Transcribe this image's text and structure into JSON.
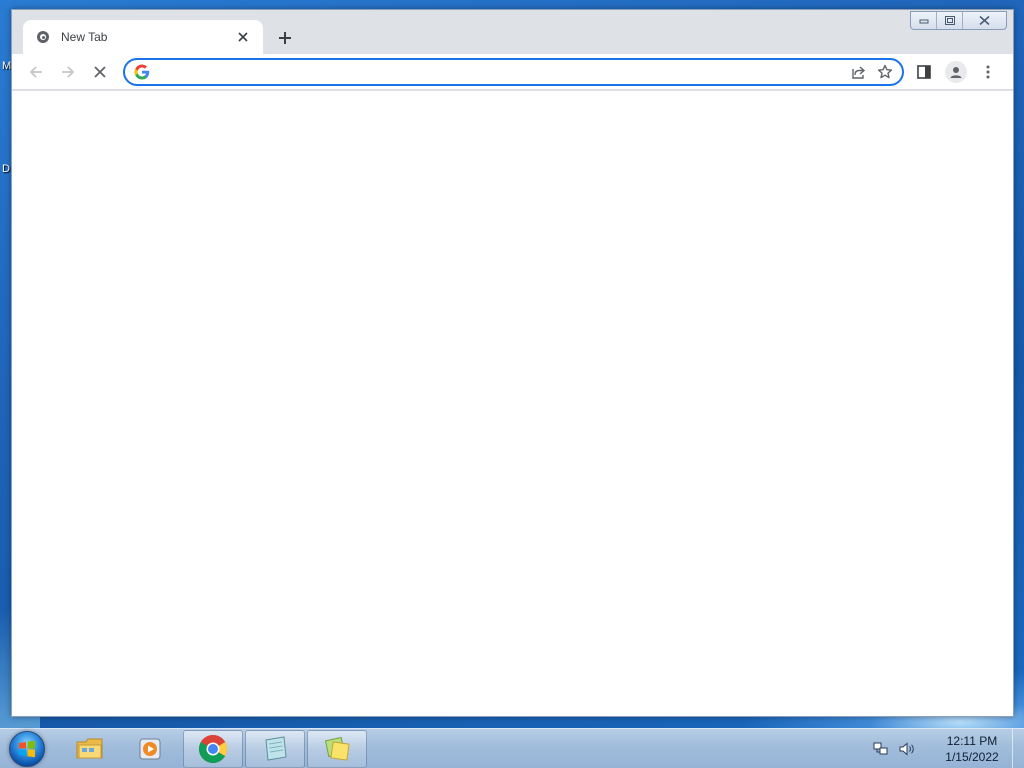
{
  "desktop": {
    "edge_labels": [
      "M",
      "D"
    ]
  },
  "browser": {
    "tab": {
      "title": "New Tab"
    },
    "omnibox": {
      "value": "",
      "placeholder": ""
    }
  },
  "icons": {
    "tab_favicon": "chrome-favicon-icon",
    "tab_close": "close-icon",
    "new_tab": "plus-icon",
    "back": "arrow-left-icon",
    "forward": "arrow-right-icon",
    "stop": "stop-icon",
    "google": "google-g-icon",
    "share": "share-icon",
    "bookmark": "star-icon",
    "side_panel": "side-panel-icon",
    "profile": "profile-icon",
    "menu": "kebab-menu-icon"
  },
  "taskbar": {
    "items": [
      {
        "name": "windows-explorer",
        "icon": "folder-icon",
        "open": false
      },
      {
        "name": "media-player",
        "icon": "media-player-icon",
        "open": false
      },
      {
        "name": "chrome",
        "icon": "chrome-icon",
        "open": true
      },
      {
        "name": "notepad",
        "icon": "notepad-icon",
        "open": true
      },
      {
        "name": "sticky-notes",
        "icon": "sticky-notes-icon",
        "open": true
      }
    ],
    "clock": {
      "time": "12:11 PM",
      "date": "1/15/2022"
    }
  },
  "colors": {
    "accent": "#1a73e8",
    "tabstrip": "#dee1e6",
    "icon_gray": "#5f6368"
  }
}
